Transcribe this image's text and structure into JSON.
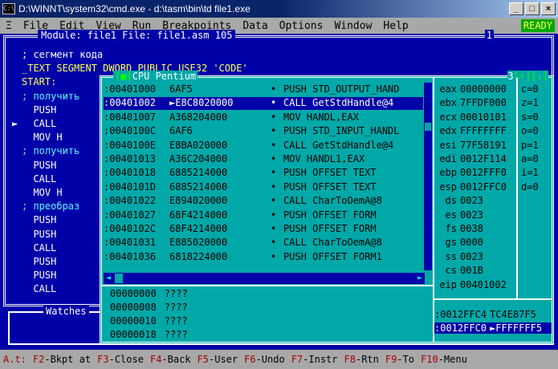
{
  "window": {
    "title": "D:\\WINNT\\system32\\cmd.exe - d:\\tasm\\bin\\td file1.exe",
    "icon_text": "C:\\"
  },
  "menu": {
    "items": [
      {
        "key": "system",
        "label": "Ξ"
      },
      {
        "key": "file",
        "label": "File"
      },
      {
        "key": "edit",
        "label": "Edit"
      },
      {
        "key": "view",
        "label": "View"
      },
      {
        "key": "run",
        "label": "Run"
      },
      {
        "key": "breakpoints",
        "label": "Breakpoints"
      },
      {
        "key": "data",
        "label": "Data"
      },
      {
        "key": "options",
        "label": "Options"
      },
      {
        "key": "window",
        "label": "Window"
      },
      {
        "key": "help",
        "label": "Help"
      }
    ],
    "status": "READY"
  },
  "module": {
    "title": "Module: file1 File: file1.asm 105",
    "number": "1",
    "lines": [
      "; сегмент кода",
      "_TEXT SEGMENT DWORD PUBLIC USE32 'CODE'",
      "START:",
      "; получить",
      "  PUSH",
      "  CALL",
      "  MOV H",
      "; получить",
      "  PUSH",
      "  CALL",
      "  MOV H",
      "; преобраз",
      "  PUSH",
      "  PUSH",
      "  CALL",
      "  PUSH",
      "  PUSH",
      "  CALL"
    ],
    "marker": "►"
  },
  "cpu": {
    "title": "CPU Pentium",
    "title_box_left": "[■]",
    "number": "3",
    "title_box_right": "[↑][↓]",
    "code": [
      {
        "addr": ":00401000",
        "bytes": "6AF5",
        "instr": "PUSH STD_OUTPUT_HAND",
        "sel": false
      },
      {
        "addr": ":00401002",
        "bytes": "►E8C8020000",
        "instr": "CALL GetStdHandle@4",
        "sel": true
      },
      {
        "addr": ":00401007",
        "bytes": "A368204000",
        "instr": "MOV HANDL,EAX",
        "sel": false
      },
      {
        "addr": ":0040100C",
        "bytes": "6AF6",
        "instr": "PUSH STD_INPUT_HANDL",
        "sel": false
      },
      {
        "addr": ":0040100E",
        "bytes": "E8BA020000",
        "instr": "CALL GetStdHandle@4",
        "sel": false
      },
      {
        "addr": ":00401013",
        "bytes": "A36C204000",
        "instr": "MOV HANDL1,EAX",
        "sel": false
      },
      {
        "addr": ":00401018",
        "bytes": "6885214000",
        "instr": "PUSH OFFSET TEXT",
        "sel": false
      },
      {
        "addr": ":0040101D",
        "bytes": "6885214000",
        "instr": "PUSH OFFSET TEXT",
        "sel": false
      },
      {
        "addr": ":00401022",
        "bytes": "E894020000",
        "instr": "CALL CharToOemA@8",
        "sel": false
      },
      {
        "addr": ":00401027",
        "bytes": "68F4214000",
        "instr": "PUSH OFFSET FORM",
        "sel": false
      },
      {
        "addr": ":0040102C",
        "bytes": "68F4214000",
        "instr": "PUSH OFFSET FORM",
        "sel": false
      },
      {
        "addr": ":00401031",
        "bytes": "E885020000",
        "instr": "CALL CharToOemA@8",
        "sel": false
      },
      {
        "addr": ":00401036",
        "bytes": "6818224000",
        "instr": "PUSH OFFSET FORM1",
        "sel": false
      }
    ],
    "registers": [
      {
        "name": "eax",
        "value": "00000000"
      },
      {
        "name": "ebx",
        "value": "7FFDF000"
      },
      {
        "name": "ecx",
        "value": "00010101"
      },
      {
        "name": "edx",
        "value": "FFFFFFFF"
      },
      {
        "name": "esi",
        "value": "77F58191"
      },
      {
        "name": "edi",
        "value": "0012F114"
      },
      {
        "name": "ebp",
        "value": "0012FFF0"
      },
      {
        "name": "esp",
        "value": "0012FFC0"
      },
      {
        "name": "ds",
        "value": "0023"
      },
      {
        "name": "es",
        "value": "0023"
      },
      {
        "name": "fs",
        "value": "0038"
      },
      {
        "name": "gs",
        "value": "0000"
      },
      {
        "name": "ss",
        "value": "0023"
      },
      {
        "name": "cs",
        "value": "001B"
      },
      {
        "name": "eip",
        "value": "00401002"
      }
    ],
    "flags": [
      {
        "name": "c",
        "value": "0"
      },
      {
        "name": "z",
        "value": "1"
      },
      {
        "name": "s",
        "value": "0"
      },
      {
        "name": "o",
        "value": "0"
      },
      {
        "name": "p",
        "value": "1"
      },
      {
        "name": "a",
        "value": "0"
      },
      {
        "name": "i",
        "value": "1"
      },
      {
        "name": "d",
        "value": "0"
      }
    ],
    "dump": [
      {
        "addr": "00000000",
        "val": "????"
      },
      {
        "addr": "00000008",
        "val": "????"
      },
      {
        "addr": "00000010",
        "val": "????"
      },
      {
        "addr": "00000018",
        "val": "????"
      }
    ],
    "stack": [
      {
        "addr": ":0012FFC4",
        "val": "TC4E87F5",
        "sel": false
      },
      {
        "addr": ":0012FFC0",
        "val": "►FFFFFFF5",
        "sel": true
      }
    ]
  },
  "watches": {
    "title": "Watches"
  },
  "statusbar": {
    "items": [
      {
        "key": "A.t:",
        "label": ""
      },
      {
        "key": "F2",
        "label": "-Bkpt at"
      },
      {
        "key": "F3",
        "label": "-Close"
      },
      {
        "key": "F4",
        "label": "-Back"
      },
      {
        "key": "F5",
        "label": "-User"
      },
      {
        "key": "F6",
        "label": "-Undo"
      },
      {
        "key": "F7",
        "label": "-Instr"
      },
      {
        "key": "F8",
        "label": "-Rtn"
      },
      {
        "key": "F9",
        "label": "-To"
      },
      {
        "key": "F10",
        "label": "-Menu"
      }
    ]
  },
  "colors": {
    "desktop_blue": "#0000a8",
    "cpu_cyan": "#00a8a8",
    "menu_gray": "#a8a8a8",
    "hotkey_red": "#a80000",
    "ready_green": "#00a800"
  }
}
